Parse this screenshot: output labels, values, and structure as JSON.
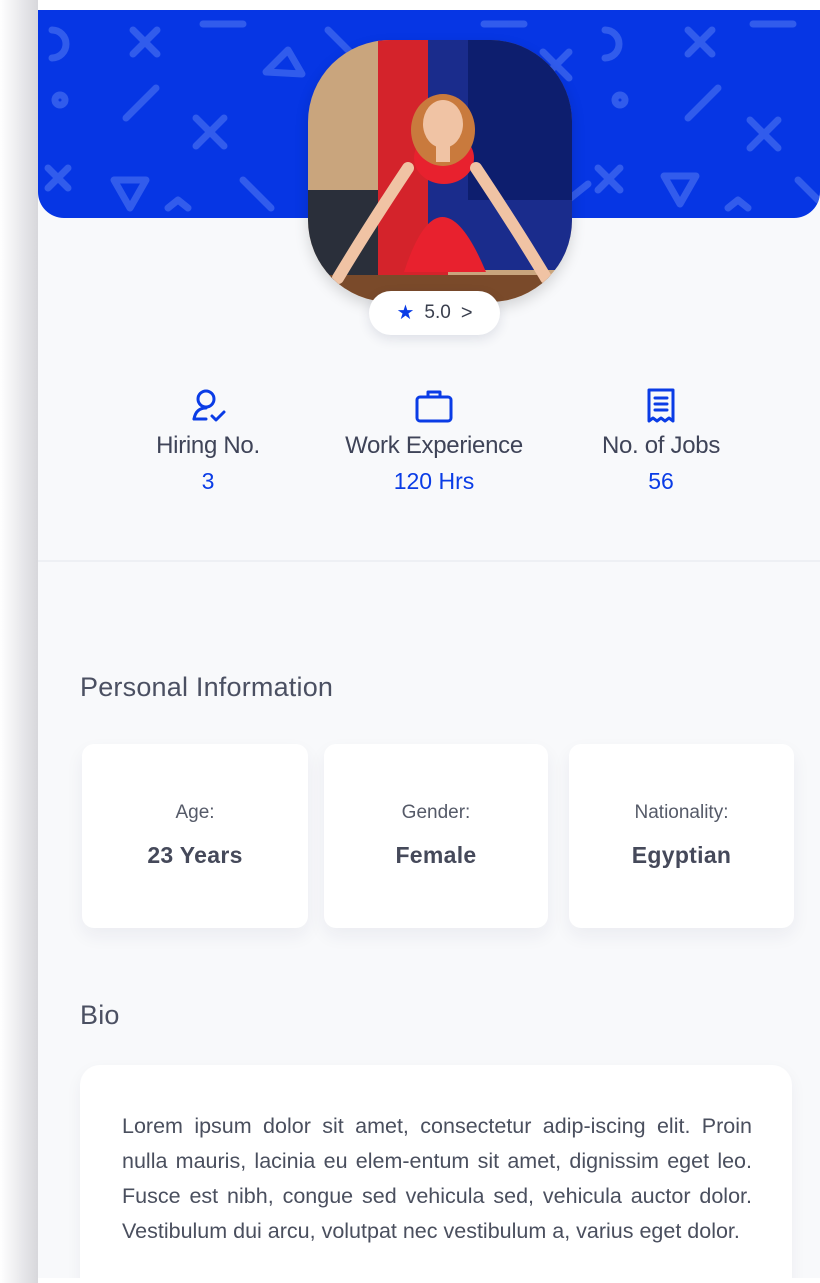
{
  "profile": {
    "rating": "5.0",
    "rating_chevron": ">"
  },
  "stats": [
    {
      "icon": "user-check-icon",
      "label": "Hiring No.",
      "value": "3"
    },
    {
      "icon": "briefcase-icon",
      "label": "Work Experience",
      "value": "120 Hrs"
    },
    {
      "icon": "receipt-icon",
      "label": "No. of Jobs",
      "value": "56"
    }
  ],
  "personal_info": {
    "title": "Personal Information",
    "items": [
      {
        "key": "Age:",
        "value": "23 Years"
      },
      {
        "key": "Gender:",
        "value": "Female"
      },
      {
        "key": "Nationality:",
        "value": "Egyptian"
      }
    ]
  },
  "bio": {
    "title": "Bio",
    "text": "Lorem ipsum dolor sit amet, consectetur adip-iscing elit. Proin nulla mauris, lacinia eu elem-entum sit amet, dignissim eget leo. Fusce est nibh, congue sed vehicula sed, vehicula auctor dolor. Vestibulum dui arcu, volutpat nec vestibulum a, varius eget dolor."
  },
  "colors": {
    "accent": "#0a3ce6",
    "header": "#0636e4",
    "background": "#f8f9fb"
  }
}
